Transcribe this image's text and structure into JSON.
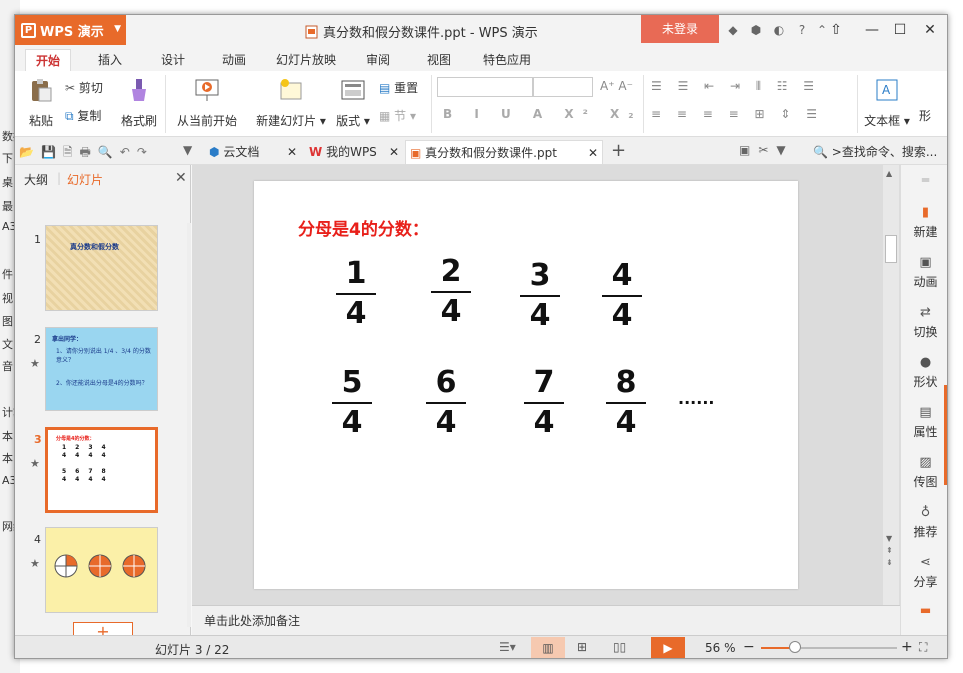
{
  "behind": [
    "数据",
    "下",
    "桌",
    "最",
    "A3",
    "件",
    "视",
    "图",
    "文",
    "音",
    "计算",
    "本",
    "本",
    "A3",
    "网络"
  ],
  "app": {
    "name": "WPS 演示",
    "doc_title": "真分数和假分数课件.ppt - WPS 演示",
    "login": "未登录"
  },
  "tabs": [
    "开始",
    "插入",
    "设计",
    "动画",
    "幻灯片放映",
    "审阅",
    "视图",
    "特色应用"
  ],
  "ribbon": {
    "paste": "粘贴",
    "cut": "剪切",
    "copy": "复制",
    "format_painter": "格式刷",
    "from_current": "从当前开始",
    "new_slide": "新建幻灯片",
    "layout": "版式",
    "reset": "重置",
    "section": "节",
    "textbox": "文本框",
    "shape": "形"
  },
  "doc_tabs": {
    "cloud": "云文档",
    "mywps": "我的WPS",
    "current": "真分数和假分数课件.ppt",
    "search": ">查找命令、搜索..."
  },
  "left_panel": {
    "tab_outline": "大纲",
    "tab_slides": "幻灯片"
  },
  "thumbs": [
    {
      "num": "1",
      "title": "真分数和假分数"
    },
    {
      "num": "2",
      "title": "拿出同学：",
      "q1": "1、请你分别说出 1/4 、3/4 的分数意义？",
      "q2": "2、你还能说出分母是4的分数吗？"
    },
    {
      "num": "3",
      "title": "分母是4的分数："
    },
    {
      "num": "4"
    }
  ],
  "slide": {
    "heading": "分母是4的分数：",
    "row1": [
      {
        "n": "1",
        "d": "4"
      },
      {
        "n": "2",
        "d": "4"
      },
      {
        "n": "3",
        "d": "4"
      },
      {
        "n": "4",
        "d": "4"
      }
    ],
    "row2": [
      {
        "n": "5",
        "d": "4"
      },
      {
        "n": "6",
        "d": "4"
      },
      {
        "n": "7",
        "d": "4"
      },
      {
        "n": "8",
        "d": "4"
      }
    ],
    "ellipsis": "......"
  },
  "sidebar": [
    "新建",
    "动画",
    "切换",
    "形状",
    "属性",
    "传图",
    "推荐",
    "分享"
  ],
  "notes": "单击此处添加备注",
  "status": {
    "slide": "幻灯片 3 / 22",
    "zoom": "56 %"
  },
  "colors": {
    "accent": "#e86a2a",
    "heading_red": "#e8201a",
    "login": "#e86a55"
  }
}
